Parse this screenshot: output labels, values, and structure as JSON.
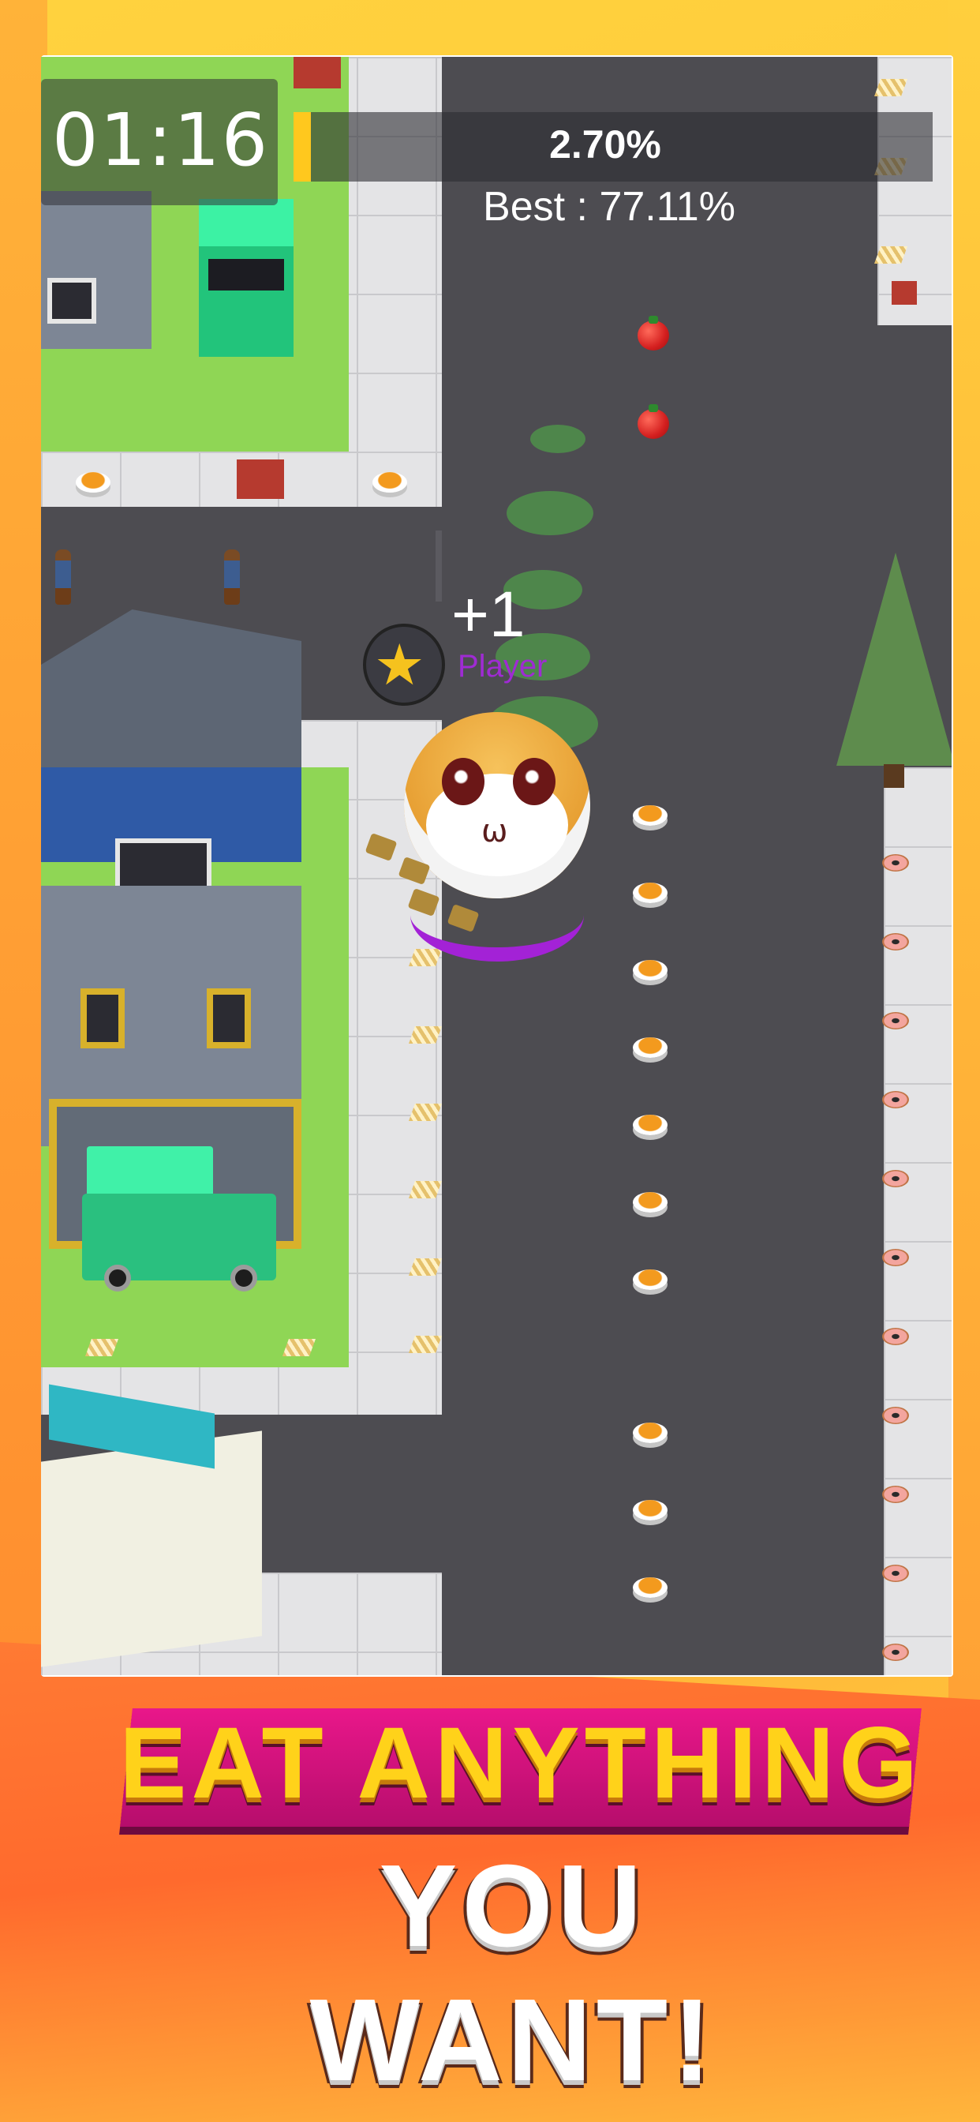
{
  "hud": {
    "timer": "01:16",
    "progress_percent": "2.70%",
    "progress_fraction": 0.027,
    "best": "Best : 77.11%"
  },
  "player": {
    "score_popup": "+1",
    "name": "Player",
    "skin_icon": "cat-face-icon",
    "rank_icon": "gold-star-medal-icon"
  },
  "banner": {
    "line1": "EAT ANYTHING",
    "line2": "YOU WANT!"
  },
  "colors": {
    "accent_yellow": "#ffc81e",
    "player_purple": "#a322d6",
    "banner_pink": "#e9178a",
    "road": "#4d4c51"
  }
}
